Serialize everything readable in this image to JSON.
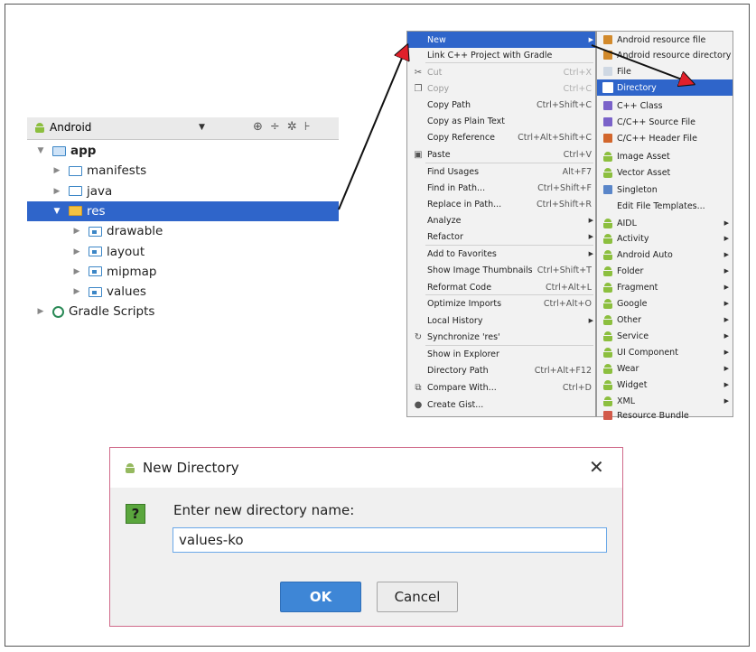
{
  "project": {
    "view_selector": "Android",
    "items": [
      {
        "label": "app",
        "indent": 0,
        "expanded": true,
        "icon": "app-folder-icon",
        "bold": true
      },
      {
        "label": "manifests",
        "indent": 1,
        "expanded": false,
        "icon": "folder-icon"
      },
      {
        "label": "java",
        "indent": 1,
        "expanded": false,
        "icon": "folder-icon"
      },
      {
        "label": "res",
        "indent": 1,
        "expanded": true,
        "icon": "res-folder-icon",
        "selected": true
      },
      {
        "label": "drawable",
        "indent": 2,
        "expanded": false,
        "icon": "folder-icon"
      },
      {
        "label": "layout",
        "indent": 2,
        "expanded": false,
        "icon": "folder-icon"
      },
      {
        "label": "mipmap",
        "indent": 2,
        "expanded": false,
        "icon": "folder-icon"
      },
      {
        "label": "values",
        "indent": 2,
        "expanded": false,
        "icon": "folder-icon"
      },
      {
        "label": "Gradle Scripts",
        "indent": 0,
        "expanded": false,
        "icon": "gradle-icon"
      }
    ]
  },
  "context_menu": {
    "items": [
      {
        "label": "New",
        "highlighted": true,
        "submenu": true
      },
      {
        "label": "Link C++ Project with Gradle"
      },
      {
        "label": "Cut",
        "shortcut": "Ctrl+X",
        "disabled": true,
        "icon": "cut-icon"
      },
      {
        "label": "Copy",
        "shortcut": "Ctrl+C",
        "disabled": true,
        "icon": "copy-icon"
      },
      {
        "label": "Copy Path",
        "shortcut": "Ctrl+Shift+C"
      },
      {
        "label": "Copy as Plain Text"
      },
      {
        "label": "Copy Reference",
        "shortcut": "Ctrl+Alt+Shift+C"
      },
      {
        "label": "Paste",
        "shortcut": "Ctrl+V",
        "icon": "paste-icon"
      },
      {
        "label": "Find Usages",
        "shortcut": "Alt+F7"
      },
      {
        "label": "Find in Path...",
        "shortcut": "Ctrl+Shift+F"
      },
      {
        "label": "Replace in Path...",
        "shortcut": "Ctrl+Shift+R"
      },
      {
        "label": "Analyze",
        "submenu": true
      },
      {
        "label": "Refactor",
        "submenu": true
      },
      {
        "label": "Add to Favorites",
        "submenu": true
      },
      {
        "label": "Show Image Thumbnails",
        "shortcut": "Ctrl+Shift+T"
      },
      {
        "label": "Reformat Code",
        "shortcut": "Ctrl+Alt+L"
      },
      {
        "label": "Optimize Imports",
        "shortcut": "Ctrl+Alt+O"
      },
      {
        "label": "Local History",
        "submenu": true
      },
      {
        "label": "Synchronize 'res'",
        "icon": "sync-icon"
      },
      {
        "label": "Show in Explorer"
      },
      {
        "label": "Directory Path",
        "shortcut": "Ctrl+Alt+F12"
      },
      {
        "label": "Compare With...",
        "shortcut": "Ctrl+D",
        "icon": "compare-icon"
      },
      {
        "label": "Create Gist...",
        "icon": "github-icon"
      }
    ]
  },
  "new_submenu": {
    "items": [
      {
        "label": "Android resource file",
        "icon": "resource-file-icon"
      },
      {
        "label": "Android resource directory",
        "icon": "resource-dir-icon"
      },
      {
        "label": "File",
        "icon": "file-icon"
      },
      {
        "label": "Directory",
        "icon": "directory-icon",
        "highlighted": true
      },
      {
        "label": "C++ Class",
        "icon": "cpp-class-icon"
      },
      {
        "label": "C/C++ Source File",
        "icon": "cpp-source-icon"
      },
      {
        "label": "C/C++ Header File",
        "icon": "cpp-header-icon"
      },
      {
        "label": "Image Asset",
        "icon": "android-icon"
      },
      {
        "label": "Vector Asset",
        "icon": "android-icon"
      },
      {
        "label": "Singleton",
        "icon": "singleton-icon"
      },
      {
        "label": "Edit File Templates..."
      },
      {
        "label": "AIDL",
        "icon": "android-icon",
        "submenu": true
      },
      {
        "label": "Activity",
        "icon": "android-icon",
        "submenu": true
      },
      {
        "label": "Android Auto",
        "icon": "android-icon",
        "submenu": true
      },
      {
        "label": "Folder",
        "icon": "android-icon",
        "submenu": true
      },
      {
        "label": "Fragment",
        "icon": "android-icon",
        "submenu": true
      },
      {
        "label": "Google",
        "icon": "android-icon",
        "submenu": true
      },
      {
        "label": "Other",
        "icon": "android-icon",
        "submenu": true
      },
      {
        "label": "Service",
        "icon": "android-icon",
        "submenu": true
      },
      {
        "label": "UI Component",
        "icon": "android-icon",
        "submenu": true
      },
      {
        "label": "Wear",
        "icon": "android-icon",
        "submenu": true
      },
      {
        "label": "Widget",
        "icon": "android-icon",
        "submenu": true
      },
      {
        "label": "XML",
        "icon": "android-icon",
        "submenu": true
      },
      {
        "label": "Resource Bundle",
        "icon": "resource-bundle-icon"
      }
    ]
  },
  "dialog": {
    "title": "New Directory",
    "close": "✕",
    "question_mark": "?",
    "prompt": "Enter new directory name:",
    "input_value": "values-ko",
    "ok_label": "OK",
    "cancel_label": "Cancel"
  },
  "colors": {
    "selection": "#2f65ca",
    "android_green": "#8cbf3f",
    "arrow": "#111111",
    "arrow_head": "#e0202a"
  }
}
